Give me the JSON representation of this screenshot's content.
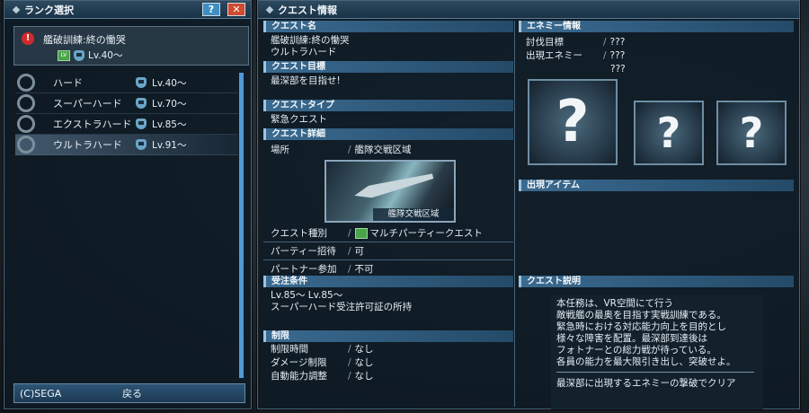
{
  "rank_window": {
    "title": "ランク選択",
    "help_label": "?",
    "close_label": "✕",
    "quest_name": "艦破訓練:終の慟哭",
    "quest_badge": "LV",
    "quest_level": "Lv.40〜",
    "ranks": [
      {
        "label": "ハード",
        "level": "Lv.40〜",
        "selected": false
      },
      {
        "label": "スーパーハード",
        "level": "Lv.70〜",
        "selected": false
      },
      {
        "label": "エクストラハード",
        "level": "Lv.85〜",
        "selected": false
      },
      {
        "label": "ウルトラハード",
        "level": "Lv.91〜",
        "selected": true
      }
    ],
    "copyright": "(C)SEGA",
    "back_label": "戻る"
  },
  "quest_info": {
    "title": "クエスト情報",
    "name_head": "クエスト名",
    "name_line1": "艦破訓練:終の慟哭",
    "name_line2": "ウルトラハード",
    "goal_head": "クエスト目標",
    "goal": "最深部を目指せ!",
    "type_head": "クエストタイプ",
    "type": "緊急クエスト",
    "detail_head": "クエスト詳細",
    "location_key": "場所",
    "location": "艦隊交戦区域",
    "location_caption": "艦隊交戦区域",
    "kind_key": "クエスト種別",
    "kind": "マルチパーティークエスト",
    "party_key": "パーティー招待",
    "party": "可",
    "partner_key": "パートナー参加",
    "partner": "不可",
    "cond_head": "受注条件",
    "cond_levels": "Lv.85〜 Lv.85〜",
    "cond_permit": "スーパーハード受注許可証の所持",
    "limit_head": "制限",
    "time_key": "制限時間",
    "time": "なし",
    "damage_key": "ダメージ制限",
    "damage": "なし",
    "auto_key": "自動能力調整",
    "auto": "なし"
  },
  "enemy_info": {
    "head": "エネミー情報",
    "target_key": "討伐目標",
    "target": "???",
    "appear_key": "出現エネミー",
    "appear1": "???",
    "appear2": "???",
    "unknown_mark": "?",
    "items_head": "出現アイテム",
    "desc_head": "クエスト説明",
    "desc_lines": [
      "本任務は、VR空間にて行う",
      "敵戦艦の最奥を目指す実戦訓練である。",
      "緊急時における対応能力向上を目的とし",
      "様々な障害を配置。最深部到達後は",
      "フォトナーとの総力戦が待っている。",
      "各員の能力を最大限引き出し、突破せよ。"
    ],
    "clear_condition": "最深部に出現するエネミーの撃破でクリア"
  },
  "colors": {
    "accent": "#4f9ad6",
    "close": "#d04a30",
    "help": "#3f8fc4",
    "badge": "#4aa44a"
  },
  "icons": [
    "alert-icon",
    "ring-icon",
    "class-icon",
    "question-icon"
  ]
}
